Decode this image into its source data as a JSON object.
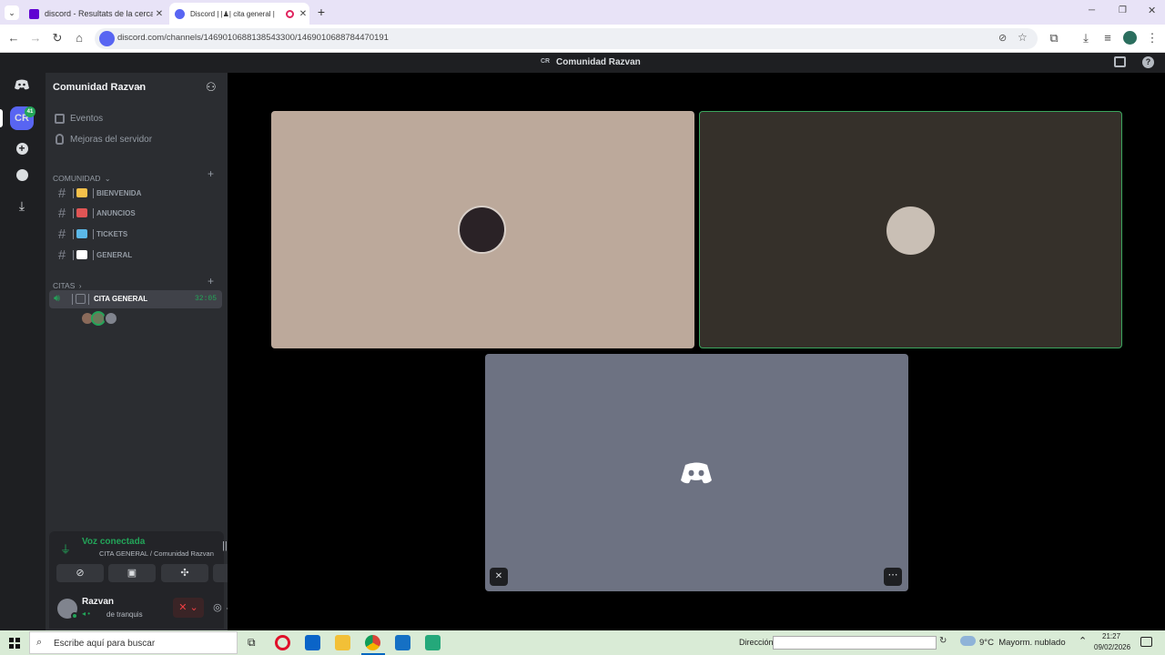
{
  "browser": {
    "tabs": [
      {
        "title": "discord - Resultats de la cerca Y",
        "favicon_color": "#6001d2"
      },
      {
        "title": "Discord | |♟| cita general |",
        "favicon_color": "#5865f2"
      }
    ],
    "url": "discord.com/channels/1469010688138543300/1469010688784470191"
  },
  "discord": {
    "window_title": "Comunidad Razvan",
    "server_badge": "CR",
    "server_name": "Comunidad Razvan",
    "server_icon_label": "CR",
    "server_icon_badge": "41",
    "menu": [
      {
        "label": "Eventos",
        "icon": "calendar-icon"
      },
      {
        "label": "Mejoras del servidor",
        "icon": "boost-icon"
      }
    ],
    "categories": {
      "comunidad": "COMUNIDAD",
      "citas": "CITAS"
    },
    "channels": [
      {
        "label": "BIENVENIDA",
        "emoji_color": "#f5c04a"
      },
      {
        "label": "ANUNCIOS",
        "emoji_color": "#e05555"
      },
      {
        "label": "TICKETS",
        "emoji_color": "#5bb8e8"
      },
      {
        "label": "GENERAL",
        "emoji_color": "#ffffff"
      }
    ],
    "voice_channel": {
      "label": "CITA GENERAL",
      "timer": "32:05"
    },
    "voice_panel": {
      "status": "Voz conectada",
      "location": "CITA GENERAL / Comunidad Razvan"
    },
    "user": {
      "name": "Razvan",
      "status": "de tranquis"
    }
  },
  "taskbar": {
    "search_placeholder": "Escribe aquí para buscar",
    "address_label": "Dirección",
    "weather": "9°C  Mayorm. nublado",
    "time": "21:27",
    "date": "09/02/2026"
  },
  "colors": {
    "tile1": "#bca99b",
    "tile2": "#35302a",
    "tile3": "#6d7282",
    "speaking_outline": "#3ba55d",
    "blurple": "#5865f2"
  }
}
